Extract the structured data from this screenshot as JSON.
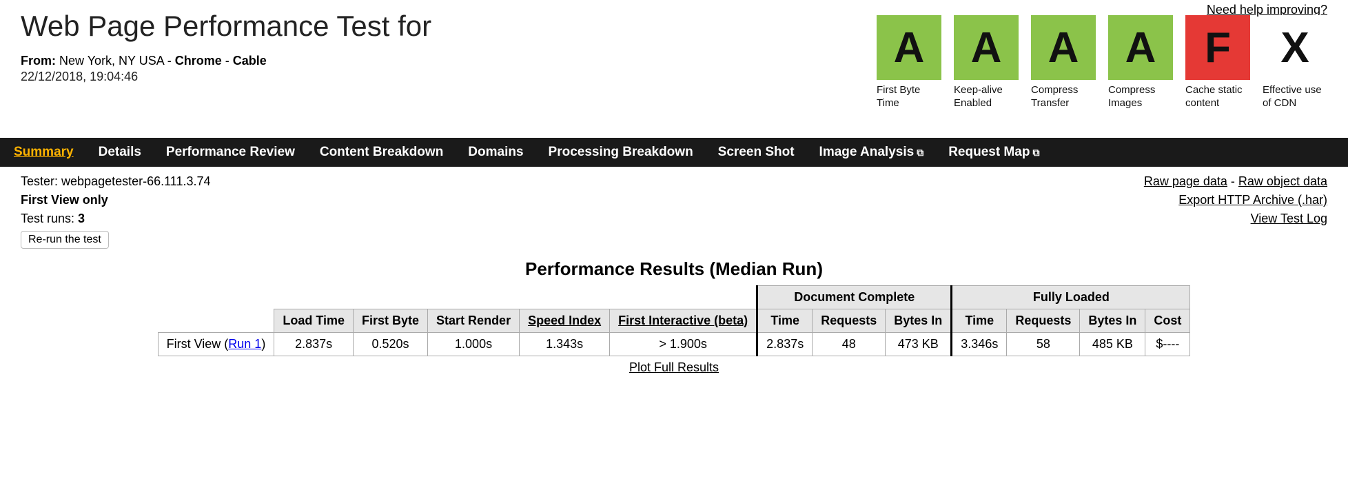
{
  "help_link": "Need help improving?",
  "header": {
    "title": "Web Page Performance Test for",
    "from_label": "From:",
    "from_location": "New York, NY USA",
    "from_sep": " - ",
    "from_browser": "Chrome",
    "from_connection": "Cable",
    "timestamp": "22/12/2018, 19:04:46"
  },
  "grades": [
    {
      "letter": "A",
      "cls": "grade-A",
      "label": "First Byte Time"
    },
    {
      "letter": "A",
      "cls": "grade-A",
      "label": "Keep-alive Enabled"
    },
    {
      "letter": "A",
      "cls": "grade-A",
      "label": "Compress Transfer"
    },
    {
      "letter": "A",
      "cls": "grade-A",
      "label": "Compress Images"
    },
    {
      "letter": "F",
      "cls": "grade-F",
      "label": "Cache static content"
    },
    {
      "letter": "X",
      "cls": "grade-X",
      "label": "Effective use of CDN"
    }
  ],
  "nav": {
    "summary": "Summary",
    "details": "Details",
    "perf_review": "Performance Review",
    "content_breakdown": "Content Breakdown",
    "domains": "Domains",
    "processing_breakdown": "Processing Breakdown",
    "screen_shot": "Screen Shot",
    "image_analysis": "Image Analysis",
    "request_map": "Request Map"
  },
  "meta": {
    "tester_label": "Tester: ",
    "tester_value": "webpagetester-66.111.3.74",
    "first_view_only": "First View only",
    "runs_label": "Test runs: ",
    "runs_value": "3",
    "rerun": "Re-run the test"
  },
  "right_links": {
    "raw_page": "Raw page data",
    "raw_object": "Raw object data",
    "export_har": "Export HTTP Archive (.har)",
    "view_log": "View Test Log",
    "sep": " - "
  },
  "results": {
    "heading": "Performance Results (Median Run)",
    "group_doc": "Document Complete",
    "group_full": "Fully Loaded",
    "cols": {
      "load_time": "Load Time",
      "first_byte": "First Byte",
      "start_render": "Start Render",
      "speed_index": "Speed Index",
      "first_interactive": "First Interactive (beta)",
      "time": "Time",
      "requests": "Requests",
      "bytes_in": "Bytes In",
      "cost": "Cost"
    },
    "row": {
      "label_prefix": "First View (",
      "label_link": "Run 1",
      "label_suffix": ")",
      "load_time": "2.837s",
      "first_byte": "0.520s",
      "start_render": "1.000s",
      "speed_index": "1.343s",
      "first_interactive": "> 1.900s",
      "dc_time": "2.837s",
      "dc_requests": "48",
      "dc_bytes": "473 KB",
      "fl_time": "3.346s",
      "fl_requests": "58",
      "fl_bytes": "485 KB",
      "cost": "$----"
    },
    "plot_link": "Plot Full Results"
  }
}
